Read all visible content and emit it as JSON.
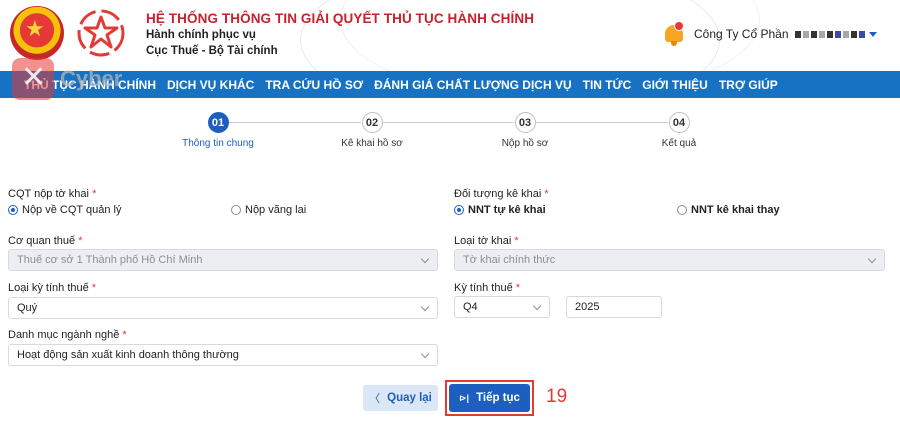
{
  "header": {
    "title": "HỆ THỐNG THÔNG TIN GIẢI QUYẾT THỦ TỤC HÀNH CHÍNH",
    "subtitle1": "Hành chính phục vụ",
    "subtitle2": "Cục Thuế - Bộ Tài chính",
    "user_name": "Công Ty Cổ Phần",
    "watermark": "Cyber"
  },
  "nav": {
    "items": [
      "THỦ TỤC HÀNH CHÍNH",
      "DỊCH VỤ KHÁC",
      "TRA CỨU HỒ SƠ",
      "ĐÁNH GIÁ CHẤT LƯỢNG DỊCH VỤ",
      "TIN TỨC",
      "GIỚI THIỆU",
      "TRỢ GIÚP"
    ]
  },
  "stepper": {
    "steps": [
      {
        "num": "01",
        "label": "Thông tin chung"
      },
      {
        "num": "02",
        "label": "Kê khai hồ sơ"
      },
      {
        "num": "03",
        "label": "Nộp hồ sơ"
      },
      {
        "num": "04",
        "label": "Kết quả"
      }
    ],
    "active_index": 0
  },
  "form": {
    "cqt_label": "CQT nộp tờ khai",
    "cqt_options": [
      "Nộp về CQT quản lý",
      "Nộp vãng lai"
    ],
    "cqt_selected": 0,
    "doituong_label": "Đối tượng kê khai",
    "doituong_options": [
      "NNT tự kê khai",
      "NNT kê khai thay"
    ],
    "doituong_selected": 0,
    "coquan_label": "Cơ quan thuế",
    "coquan_value": "Thuế cơ sở 1 Thành phố Hồ Chí Minh",
    "loaitokhai_label": "Loại tờ khai",
    "loaitokhai_value": "Tờ khai chính thức",
    "loaiky_label": "Loại kỳ tính thuế",
    "loaiky_value": "Quý",
    "kytinh_label": "Kỳ tính thuế",
    "kytinh_quarter": "Q4",
    "kytinh_year": "2025",
    "danhmuc_label": "Danh mục ngành nghề",
    "danhmuc_value": "Hoạt động sản xuất kinh doanh thông thường",
    "required_mark": "*"
  },
  "buttons": {
    "back_label": "Quay lại",
    "back_icon": "chevron-left-icon",
    "next_label": "Tiếp tục",
    "next_icon": "skip-next-icon"
  },
  "annotation": {
    "step_number": "19"
  },
  "colors": {
    "primary": "#1d5fbf",
    "navbar": "#1872c4",
    "brand_red": "#c8202c",
    "highlight": "#e53935"
  }
}
